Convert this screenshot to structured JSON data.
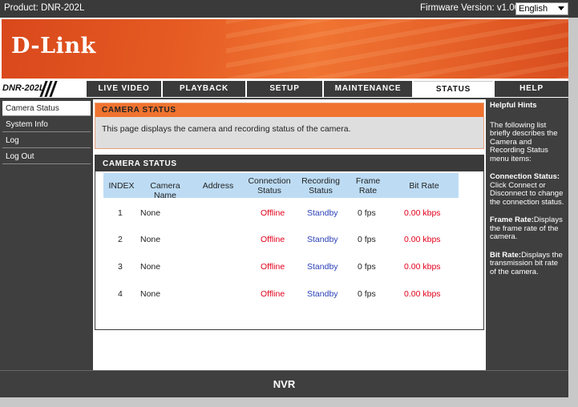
{
  "topbar": {
    "product": "Product: DNR-202L",
    "firmware": "Firmware Version: v1.00",
    "language": "English"
  },
  "banner": {
    "logo": "D-Link"
  },
  "nav": {
    "model": "DNR-202L",
    "tabs": [
      {
        "label": "LIVE VIDEO"
      },
      {
        "label": "PLAYBACK"
      },
      {
        "label": "SETUP"
      },
      {
        "label": "MAINTENANCE"
      },
      {
        "label": "STATUS"
      },
      {
        "label": "HELP"
      }
    ],
    "active_tab": "STATUS"
  },
  "sidebar": {
    "items": [
      {
        "label": "Camera Status"
      },
      {
        "label": "System Info"
      },
      {
        "label": "Log"
      },
      {
        "label": "Log Out"
      }
    ]
  },
  "main": {
    "intro_title": "CAMERA STATUS",
    "intro_text": "This page displays the camera and recording status of the camera.",
    "table_title": "CAMERA STATUS",
    "columns": [
      "INDEX",
      "Camera Name",
      "Address",
      "Connection Status",
      "Recording Status",
      "Frame Rate",
      "Bit Rate"
    ],
    "rows": [
      {
        "index": "1",
        "name": "None",
        "address": "",
        "connection": "Offline",
        "recording": "Standby",
        "frame_rate": "0 fps",
        "bit_rate": "0.00 kbps"
      },
      {
        "index": "2",
        "name": "None",
        "address": "",
        "connection": "Offline",
        "recording": "Standby",
        "frame_rate": "0 fps",
        "bit_rate": "0.00 kbps"
      },
      {
        "index": "3",
        "name": "None",
        "address": "",
        "connection": "Offline",
        "recording": "Standby",
        "frame_rate": "0 fps",
        "bit_rate": "0.00 kbps"
      },
      {
        "index": "4",
        "name": "None",
        "address": "",
        "connection": "Offline",
        "recording": "Standby",
        "frame_rate": "0 fps",
        "bit_rate": "0.00 kbps"
      }
    ]
  },
  "hints": {
    "title": "Helpful Hints",
    "intro": "The following list briefly describes the Camera and Recording Status menu items:",
    "items": [
      {
        "term": "Connection Status:",
        "desc": "Click Connect or Disconnect to change the connection status."
      },
      {
        "term": "Frame Rate:",
        "desc": "Displays the frame rate of the camera."
      },
      {
        "term": "Bit Rate:",
        "desc": "Displays the transmission bit rate of the camera."
      }
    ]
  },
  "footer": {
    "label": "NVR"
  },
  "colors": {
    "accent_orange": "#f0732f",
    "offline_red": "#e2001a",
    "standby_blue": "#2a3fb8",
    "table_header_blue": "#bddcf4",
    "dark_gray": "#3f3f3f"
  }
}
